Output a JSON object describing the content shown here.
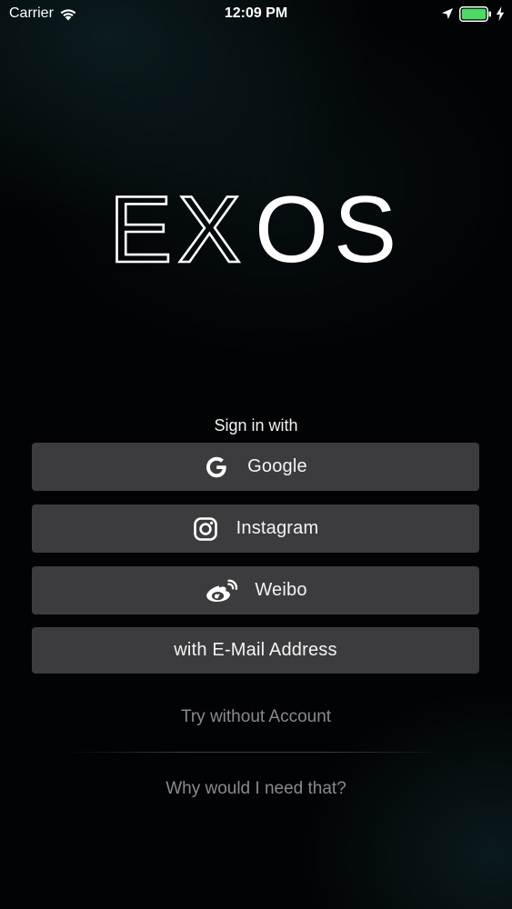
{
  "status_bar": {
    "carrier": "Carrier",
    "time": "12:09 PM",
    "icons": [
      "wifi-icon",
      "location-arrow-icon",
      "battery-icon",
      "charging-bolt-icon"
    ],
    "battery_color": "#4cd964"
  },
  "logo": {
    "text_light": "EX",
    "text_bold": "OS"
  },
  "sign_in": {
    "heading": "Sign in with",
    "buttons": {
      "google": {
        "label": "Google",
        "icon": "google-icon"
      },
      "instagram": {
        "label": "Instagram",
        "icon": "instagram-icon"
      },
      "weibo": {
        "label": "Weibo",
        "icon": "weibo-icon"
      },
      "email": {
        "label": "with E-Mail Address"
      }
    }
  },
  "links": {
    "try_without_account": "Try without Account",
    "why_need": "Why would I need that?"
  },
  "colors": {
    "button_background": "#3c3c3e",
    "link_text": "#8a8a8c",
    "background": "#020304"
  }
}
